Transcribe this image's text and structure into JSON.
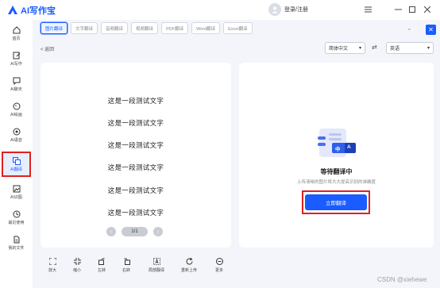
{
  "app": {
    "title": "AI写作宝",
    "login_label": "登录/注册"
  },
  "sidebar": {
    "items": [
      {
        "label": "首页",
        "icon": "home-icon"
      },
      {
        "label": "AI写作",
        "icon": "pen-icon"
      },
      {
        "label": "AI聊天",
        "icon": "chat-icon"
      },
      {
        "label": "AI绘画",
        "icon": "palette-icon"
      },
      {
        "label": "AI语音",
        "icon": "audio-icon"
      },
      {
        "label": "AI翻译",
        "icon": "translate-icon",
        "active": true
      },
      {
        "label": "AI识图",
        "icon": "image-icon"
      },
      {
        "label": "最近使用",
        "icon": "history-icon"
      },
      {
        "label": "我的文件",
        "icon": "file-icon"
      }
    ]
  },
  "tabs": [
    "图片翻译",
    "文字翻译",
    "音频翻译",
    "视频翻译",
    "PDF翻译",
    "Word翻译",
    "Excel翻译"
  ],
  "active_tab": 0,
  "back_label": "返回",
  "language": {
    "source": "简体中文",
    "target": "英语"
  },
  "document": {
    "lines": [
      "这是一段测试文字",
      "这是一段测试文字",
      "这是一段测试文字",
      "这是一段测试文字",
      "这是一段测试文字",
      "这是一段测试文字"
    ]
  },
  "pager": {
    "page": "1/1"
  },
  "toolbar": [
    {
      "label": "放大",
      "icon": "zoom-in-icon"
    },
    {
      "label": "缩小",
      "icon": "zoom-out-icon"
    },
    {
      "label": "左转",
      "icon": "rotate-left-icon"
    },
    {
      "label": "右转",
      "icon": "rotate-right-icon"
    },
    {
      "label": "局部翻译",
      "icon": "partial-translate-icon"
    },
    {
      "label": "重新上传",
      "icon": "reupload-icon"
    },
    {
      "label": "更多",
      "icon": "more-icon"
    }
  ],
  "result": {
    "status_title": "等待翻译中",
    "status_hint": "上传清晰的图片将大大提高识别的准确度",
    "translate_button": "立即翻译",
    "illustration_chars": [
      "中",
      "A"
    ]
  },
  "watermark": "CSDN @xiehewe",
  "colors": {
    "accent": "#1a5cff",
    "highlight_border": "#e02020"
  }
}
